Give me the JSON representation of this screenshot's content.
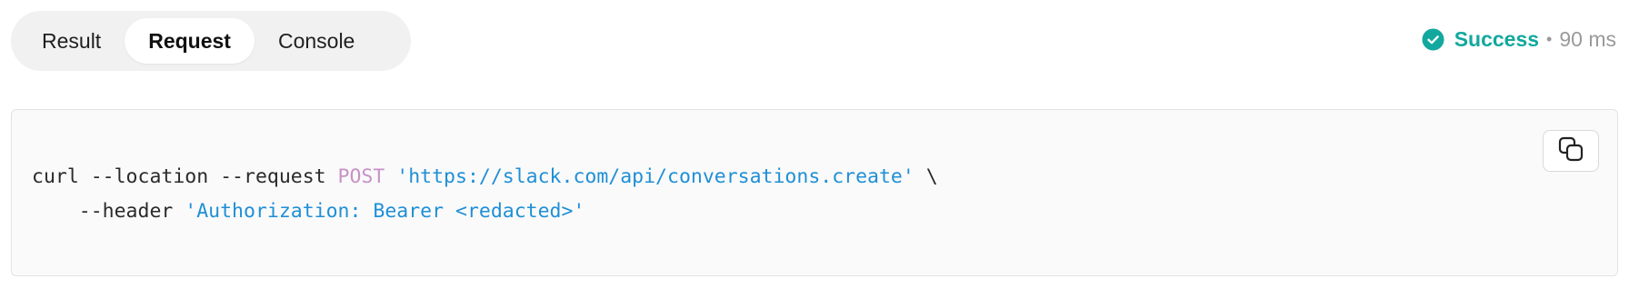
{
  "tabs": [
    {
      "label": "Result",
      "active": false
    },
    {
      "label": "Request",
      "active": true
    },
    {
      "label": "Console",
      "active": false
    }
  ],
  "status": {
    "icon": "check-circle-icon",
    "text": "Success",
    "separator": "•",
    "time": "90 ms",
    "color": "#13a89e"
  },
  "code": {
    "line1": {
      "prefix": "curl --location --request ",
      "method": "POST",
      "space": " ",
      "url": "'https://slack.com/api/conversations.create'",
      "suffix": " \\"
    },
    "line2": {
      "indent": "    --header ",
      "header": "'Authorization: Bearer <redacted>'"
    }
  },
  "copy_button": {
    "icon": "copy-icon"
  },
  "colors": {
    "method": "#c792c7",
    "string": "#1f8fd6",
    "code_bg": "#fafafa"
  }
}
